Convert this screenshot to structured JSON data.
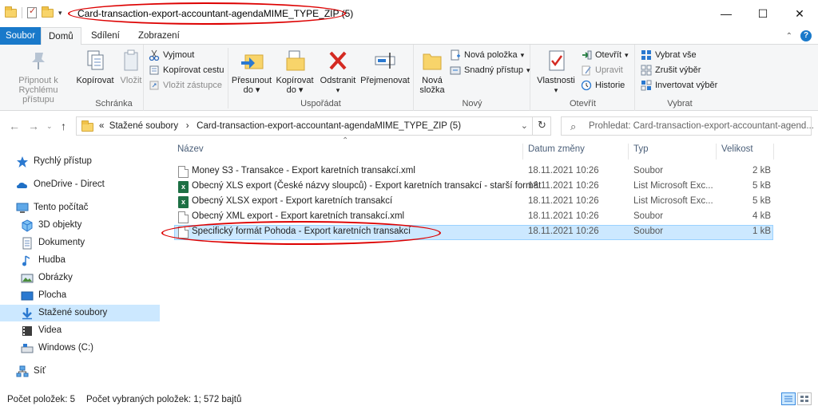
{
  "titlebar": {
    "title": "Card-transaction-export-accountant-agendaMIME_TYPE_ZIP (5)",
    "minimize": "—",
    "maximize": "☐",
    "close": "✕"
  },
  "tabs": {
    "file": "Soubor",
    "home": "Domů",
    "share": "Sdílení",
    "view": "Zobrazení"
  },
  "ribbon": {
    "clipboard": {
      "label": "Schránka",
      "pin": "Připnout k Rychlému přístupu",
      "copy": "Kopírovat",
      "paste": "Vložit",
      "cut": "Vyjmout",
      "copy_path": "Kopírovat cestu",
      "paste_shortcut": "Vložit zástupce"
    },
    "organize": {
      "label": "Uspořádat",
      "move_to": "Přesunout",
      "move_to_sub": "do",
      "copy_to": "Kopírovat",
      "copy_to_sub": "do",
      "delete": "Odstranit",
      "rename": "Přejmenovat"
    },
    "new": {
      "label": "Nový",
      "new_folder": "Nová",
      "new_folder_sub": "složka",
      "new_item": "Nová položka",
      "easy_access": "Snadný přístup"
    },
    "open": {
      "label": "Otevřít",
      "properties": "Vlastnosti",
      "open": "Otevřít",
      "edit": "Upravit",
      "history": "Historie"
    },
    "select": {
      "label": "Vybrat",
      "select_all": "Vybrat vše",
      "select_none": "Zrušit výběr",
      "invert": "Invertovat výběr"
    }
  },
  "address": {
    "prefix": "«",
    "crumb1": "Stažené soubory",
    "sep": "›",
    "crumb2": "Card-transaction-export-accountant-agendaMIME_TYPE_ZIP (5)",
    "dropdown": "⌄",
    "refresh": "↻"
  },
  "search": {
    "placeholder": "Prohledat: Card-transaction-export-accountant-agend..."
  },
  "nav": {
    "quick_access": "Rychlý přístup",
    "onedrive": "OneDrive - Direct",
    "this_pc": "Tento počítač",
    "objects3d": "3D objekty",
    "documents": "Dokumenty",
    "music": "Hudba",
    "pictures": "Obrázky",
    "desktop": "Plocha",
    "downloads": "Stažené soubory",
    "videos": "Videa",
    "windows_c": "Windows (C:)",
    "network": "Síť"
  },
  "columns": {
    "name": "Název",
    "date": "Datum změny",
    "type": "Typ",
    "size": "Velikost"
  },
  "files": [
    {
      "name": "Money S3 - Transakce - Export karetních transakcí.xml",
      "date": "18.11.2021 10:26",
      "type": "Soubor",
      "size": "2 kB",
      "icon": "doc"
    },
    {
      "name": "Obecný XLS export (České názvy sloupců) - Export karetních transakcí -  starší formát",
      "date": "18.11.2021 10:26",
      "type": "List Microsoft Exc...",
      "size": "5 kB",
      "icon": "xls"
    },
    {
      "name": "Obecný XLSX export - Export karetních transakcí",
      "date": "18.11.2021 10:26",
      "type": "List Microsoft Exc...",
      "size": "5 kB",
      "icon": "xls"
    },
    {
      "name": "Obecný XML export - Export karetních transakcí.xml",
      "date": "18.11.2021 10:26",
      "type": "Soubor",
      "size": "4 kB",
      "icon": "doc"
    },
    {
      "name": "Specifický formát Pohoda - Export karetních transakcí",
      "date": "18.11.2021 10:26",
      "type": "Soubor",
      "size": "1 kB",
      "icon": "doc"
    }
  ],
  "status": {
    "count": "Počet položek: 5",
    "selected": "Počet vybraných položek: 1; 572 bajtů"
  },
  "colors": {
    "accent": "#1979ca",
    "selection": "#cce8ff",
    "annotation": "#dd0000"
  }
}
